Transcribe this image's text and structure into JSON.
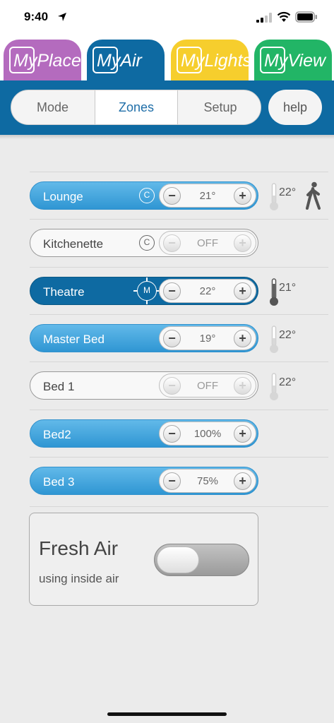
{
  "status_bar": {
    "time": "9:40"
  },
  "app_tabs": [
    {
      "label": "MyPlace"
    },
    {
      "label": "MyAir"
    },
    {
      "label": "MyLights"
    },
    {
      "label": "MyView"
    }
  ],
  "nav": {
    "segments": [
      "Mode",
      "Zones",
      "Setup"
    ],
    "selected": "Zones",
    "help_label": "help"
  },
  "zones": [
    {
      "name": "Lounge",
      "badge": "C",
      "value": "21°",
      "state": "on",
      "temp": "22°",
      "motion": true
    },
    {
      "name": "Kitchenette",
      "badge": "C",
      "value": "OFF",
      "state": "off",
      "temp": ""
    },
    {
      "name": "Theatre",
      "badge": "M",
      "value": "22°",
      "state": "selected",
      "temp": "21°"
    },
    {
      "name": "Master Bed",
      "badge": "",
      "value": "19°",
      "state": "on",
      "temp": "22°"
    },
    {
      "name": "Bed 1",
      "badge": "",
      "value": "OFF",
      "state": "off",
      "temp": "22°"
    },
    {
      "name": "Bed2",
      "badge": "",
      "value": "100%",
      "state": "on",
      "temp": ""
    },
    {
      "name": "Bed 3",
      "badge": "",
      "value": "75%",
      "state": "on",
      "temp": ""
    }
  ],
  "stepper_symbols": {
    "minus": "−",
    "plus": "+"
  },
  "fresh_air": {
    "title": "Fresh Air",
    "subtitle": "using inside air",
    "enabled": false
  },
  "colors": {
    "myplace": "#b46bbe",
    "myair": "#0e6aa2",
    "mylights": "#f6ce2d",
    "myview": "#22b566",
    "zone_on": "#3da3dd",
    "zone_selected": "#0e6aa2"
  }
}
